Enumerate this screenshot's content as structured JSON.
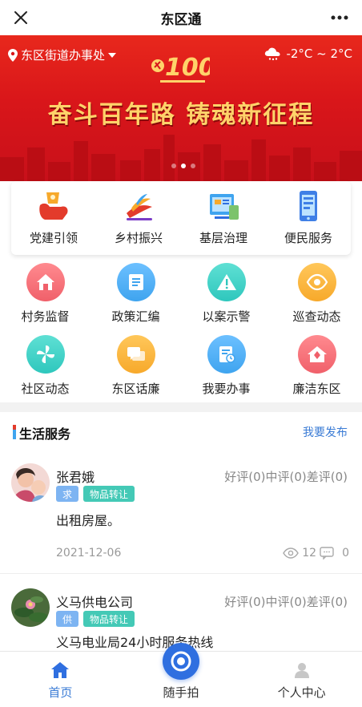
{
  "header": {
    "title": "东区通"
  },
  "banner": {
    "location": "东区街道办事处",
    "weather": "-2°C ~ 2°C",
    "emblem_text": "100",
    "slogan": "奋斗百年路  铸魂新征程",
    "slide_count": 3,
    "active_slide": 2
  },
  "main_services": [
    {
      "label": "党建引领",
      "icon": "party-building-icon"
    },
    {
      "label": "乡村振兴",
      "icon": "rural-revitalization-icon"
    },
    {
      "label": "基层治理",
      "icon": "grassroots-governance-icon"
    },
    {
      "label": "便民服务",
      "icon": "convenience-service-icon"
    }
  ],
  "grid_services": [
    {
      "label": "村务监督",
      "icon": "home-icon",
      "color": "#f0606a"
    },
    {
      "label": "政策汇编",
      "icon": "document-icon",
      "color": "#3fa4ef"
    },
    {
      "label": "以案示警",
      "icon": "warning-icon",
      "color": "#2fc7bd"
    },
    {
      "label": "巡查动态",
      "icon": "eye-icon",
      "color": "#f7a92b"
    },
    {
      "label": "社区动态",
      "icon": "pinwheel-icon",
      "color": "#2fc7bd"
    },
    {
      "label": "东区话廉",
      "icon": "chat-icon",
      "color": "#f7a92b"
    },
    {
      "label": "我要办事",
      "icon": "task-icon",
      "color": "#3fa4ef"
    },
    {
      "label": "廉洁东区",
      "icon": "house-icon",
      "color": "#f0606a"
    }
  ],
  "life_service": {
    "title": "生活服务",
    "publish_label": "我要发布",
    "posts": [
      {
        "name": "张君娥",
        "rating": "好评(0)中评(0)差评(0)",
        "tags": [
          "求",
          "物品转让"
        ],
        "description": "出租房屋。",
        "date": "2021-12-06",
        "views": "12",
        "comments": "0"
      },
      {
        "name": "义马供电公司",
        "rating": "好评(0)中评(0)差评(0)",
        "tags": [
          "供",
          "物品转让"
        ],
        "description": "义马电业局24小时服务热线"
      }
    ]
  },
  "bottom_nav": [
    {
      "label": "首页",
      "active": true
    },
    {
      "label": "随手拍",
      "active": false
    },
    {
      "label": "个人中心",
      "active": false
    }
  ],
  "colors": {
    "accent": "#3a7bd5",
    "banner_red": "#d9161a",
    "gold": "#ffd36a"
  }
}
